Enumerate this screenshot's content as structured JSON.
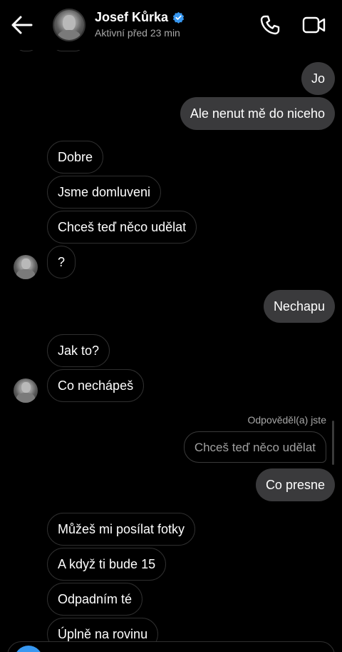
{
  "header": {
    "name": "Josef Kůrka",
    "status": "Aktivní před 23 min",
    "colors": {
      "verified": "#3797f0",
      "icon": "#ffffff"
    },
    "icons": {
      "back": "arrow-left-icon",
      "verified": "verified-badge-icon",
      "call": "phone-icon",
      "video": "video-camera-icon"
    }
  },
  "messages": [
    {
      "dir": "out",
      "text": "Jo"
    },
    {
      "dir": "out",
      "text": "Ale nenut mě do niceho"
    },
    {
      "dir": "in",
      "text": "Dobre"
    },
    {
      "dir": "in",
      "text": "Jsme domluveni"
    },
    {
      "dir": "in",
      "text": "Chceš teď něco udělat"
    },
    {
      "dir": "in",
      "text": "?"
    },
    {
      "dir": "out",
      "text": "Nechapu"
    },
    {
      "dir": "in",
      "text": "Jak to?"
    },
    {
      "dir": "in",
      "text": "Co nechápeš"
    },
    {
      "dir": "out",
      "text": "Co presne"
    },
    {
      "dir": "in",
      "text": "Můžeš mi posílat fotky"
    },
    {
      "dir": "in",
      "text": "A když ti bude 15"
    },
    {
      "dir": "in",
      "text": "Odpadním té"
    },
    {
      "dir": "in",
      "text": "Úplně na rovinu"
    }
  ],
  "reply": {
    "label": "Odpověděl(a) jste",
    "quoted": "Chceš teď něco udělat"
  },
  "colors": {
    "background": "#000000",
    "outgoing_bubble": "#3a3a3c",
    "incoming_border": "#2f2f2f",
    "accent": "#3797f0"
  }
}
